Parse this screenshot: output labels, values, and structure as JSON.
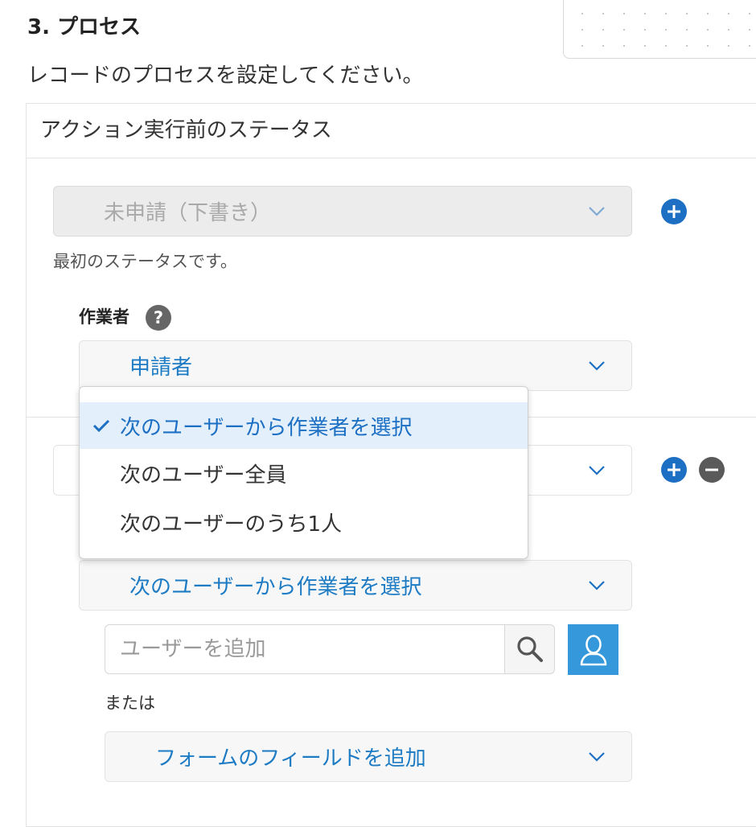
{
  "section": {
    "title": "3. プロセス",
    "description": "レコードのプロセスを設定してください。"
  },
  "status_panel": {
    "header": "アクション実行前のステータス",
    "first_status": {
      "value": "未申請（下書き）",
      "note": "最初のステータスです。"
    },
    "assignee": {
      "label": "作業者",
      "help_glyph": "?",
      "value": "申請者"
    },
    "second_status": {
      "assignee_mode_value": "次のユーザーから作業者を選択",
      "user_search": {
        "placeholder": "ユーザーを追加"
      },
      "or_label": "または",
      "field_select_value": "フォームのフィールドを追加"
    }
  },
  "assignee_mode_menu": {
    "items": [
      {
        "label": "次のユーザーから作業者を選択",
        "selected": true
      },
      {
        "label": "次のユーザー全員",
        "selected": false
      },
      {
        "label": "次のユーザーのうち1人",
        "selected": false
      }
    ]
  },
  "icons": {
    "add": "plus-circle-icon",
    "remove": "minus-circle-icon",
    "help": "question-circle-icon",
    "search": "search-icon",
    "user": "user-icon",
    "check": "checkmark-icon",
    "chevron": "chevron-down-icon"
  },
  "colors": {
    "accent_blue": "#1d6fc3",
    "link_blue": "#1d7bc4",
    "user_button_blue": "#3498db",
    "selected_bg": "#e3f0fc",
    "remove_gray": "#5a5a5a"
  }
}
